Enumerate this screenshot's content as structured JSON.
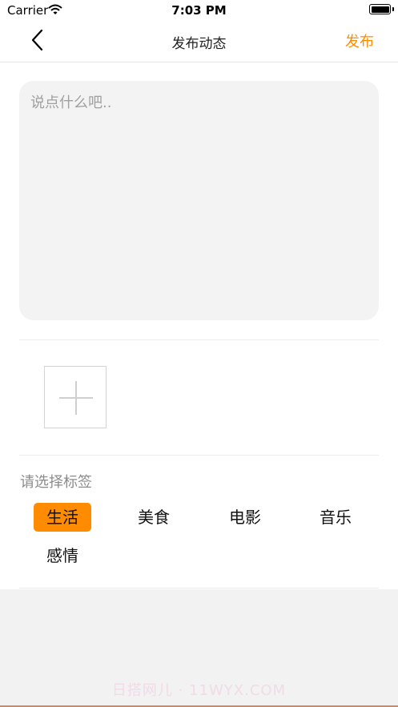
{
  "status_bar": {
    "carrier": "Carrier",
    "time": "7:03 PM",
    "battery_level": 1.0
  },
  "nav": {
    "title": "发布动态",
    "publish_label": "发布",
    "back_icon": "chevron-left-icon"
  },
  "post": {
    "placeholder": "说点什么吧..",
    "value": ""
  },
  "photo": {
    "add_icon": "plus-icon"
  },
  "tags": {
    "prompt": "请选择标签",
    "items": [
      {
        "label": "生活",
        "selected": true
      },
      {
        "label": "美食",
        "selected": false
      },
      {
        "label": "电影",
        "selected": false
      },
      {
        "label": "音乐",
        "selected": false
      },
      {
        "label": "感情",
        "selected": false
      }
    ]
  },
  "watermark": "日搭网儿 · 11WYX.COM",
  "colors": {
    "accent": "#ff8c00",
    "input_bg": "#f3f3f3",
    "background_gray": "#f2f2f2"
  }
}
